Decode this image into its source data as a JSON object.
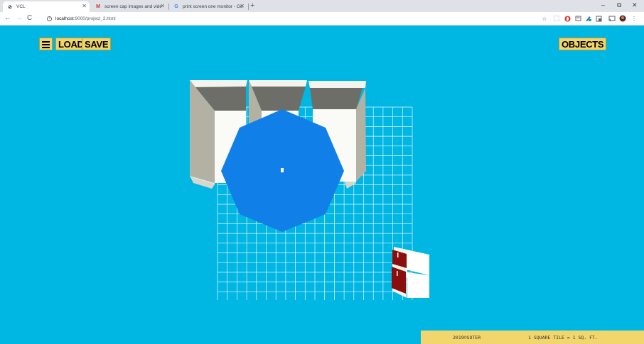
{
  "browser": {
    "tabs": [
      {
        "title": "VCL",
        "icon": "vcl-favicon-icon",
        "active": true
      },
      {
        "title": "screen cap images and video - l...",
        "icon": "gmail-icon",
        "active": false
      },
      {
        "title": "print screen one monitor - Goog...",
        "icon": "google-icon",
        "active": false
      }
    ],
    "new_tab_symbol": "+",
    "url_host": "localhost",
    "url_path": ":9000/project_2.html",
    "window_controls": [
      "–",
      "⧉",
      "✕"
    ]
  },
  "app": {
    "menu_icon": "hamburger-menu-icon",
    "load_label": "LOAD",
    "save_label": "SAVE",
    "objects_label": "OBJECTS",
    "footer_left": "2019©SOTER",
    "footer_right": "1 SQUARE TILE = 1 SQ. FT.",
    "colors": {
      "background": "#00b7e3",
      "button": "#f2d66b",
      "octagon": "#1080e8",
      "grid_lines": "#e8f6fc",
      "cabinet_red": "#8b0e0e"
    }
  }
}
